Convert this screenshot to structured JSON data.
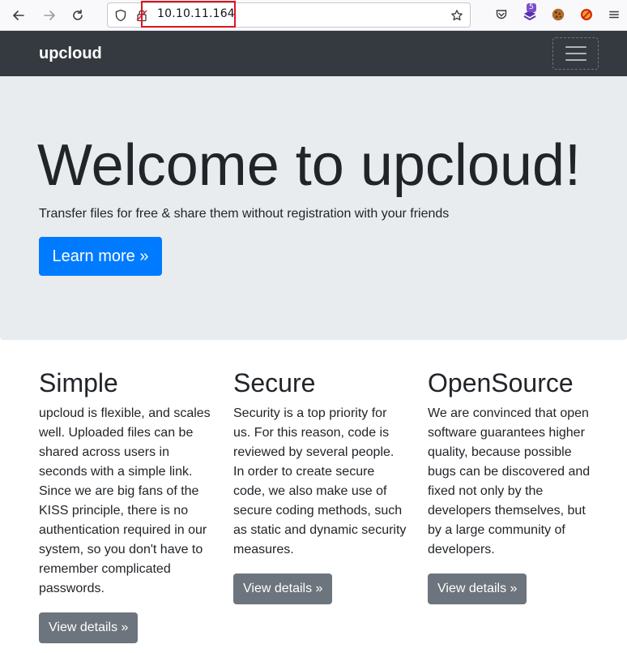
{
  "browser": {
    "url": "10.10.11.164",
    "extension_badge": "5"
  },
  "navbar": {
    "brand": "upcloud"
  },
  "hero": {
    "title": "Welcome to upcloud!",
    "subtitle": "Transfer files for free & share them without registration with your friends",
    "button_label": "Learn more »"
  },
  "features": [
    {
      "title": "Simple",
      "text": "upcloud is flexible, and scales well. Uploaded files can be shared across users in seconds with a simple link. Since we are big fans of the KISS principle, there is no authentication required in our system, so you don't have to remember complicated passwords.",
      "button_label": "View details »"
    },
    {
      "title": "Secure",
      "text": "Security is a top priority for us. For this reason, code is reviewed by several people. In order to create secure code, we also make use of secure coding methods, such as static and dynamic security measures.",
      "button_label": "View details »"
    },
    {
      "title": "OpenSource",
      "text": "We are convinced that open software guarantees higher quality, because possible bugs can be discovered and fixed not only by the developers themselves, but by a large community of developers.",
      "button_label": "View details »"
    }
  ],
  "colors": {
    "navbar_bg": "#343a40",
    "jumbotron_bg": "#e9ecef",
    "primary": "#007bff",
    "secondary": "#6c757d"
  }
}
